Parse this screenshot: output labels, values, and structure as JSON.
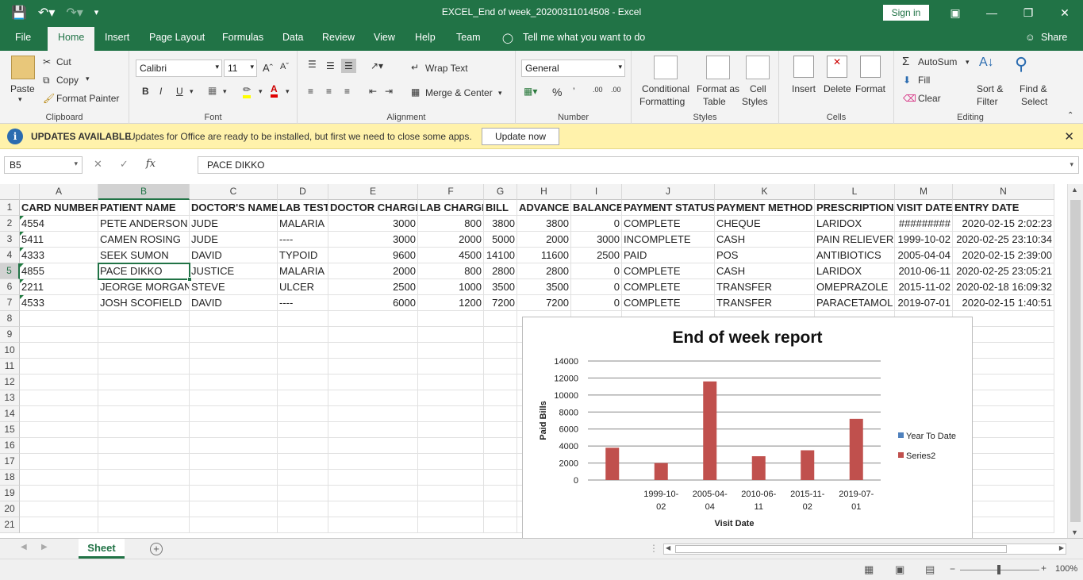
{
  "window": {
    "title": "EXCEL_End of week_20200311014508  -  Excel",
    "sign_in": "Sign in"
  },
  "tabs": [
    "File",
    "Home",
    "Insert",
    "Page Layout",
    "Formulas",
    "Data",
    "Review",
    "View",
    "Help",
    "Team"
  ],
  "tell_me": "Tell me what you want to do",
  "share": "Share",
  "ribbon": {
    "clipboard": {
      "paste": "Paste",
      "cut": "Cut",
      "copy": "Copy",
      "format_painter": "Format Painter",
      "label": "Clipboard"
    },
    "font": {
      "name": "Calibri",
      "size": "11",
      "label": "Font"
    },
    "alignment": {
      "wrap": "Wrap Text",
      "merge": "Merge & Center",
      "label": "Alignment"
    },
    "number": {
      "format": "General",
      "label": "Number"
    },
    "styles": {
      "conditional": "Conditional",
      "formatting": "Formatting",
      "format_as": "Format as",
      "table": "Table",
      "cell": "Cell",
      "cell_styles": "Styles",
      "label": "Styles"
    },
    "cells": {
      "insert": "Insert",
      "delete": "Delete",
      "format": "Format",
      "label": "Cells"
    },
    "editing": {
      "autosum": "AutoSum",
      "fill": "Fill",
      "clear": "Clear",
      "sort": "Sort &",
      "filter": "Filter",
      "find": "Find &",
      "select": "Select",
      "label": "Editing"
    }
  },
  "message_bar": {
    "title": "UPDATES AVAILABLE",
    "text": "Updates for Office are ready to be installed, but first we need to close some apps.",
    "button": "Update now"
  },
  "formula_bar": {
    "name_box": "B5",
    "formula": "PACE DIKKO"
  },
  "columns": [
    "A",
    "B",
    "C",
    "D",
    "E",
    "F",
    "G",
    "H",
    "I",
    "J",
    "K",
    "L",
    "M",
    "N"
  ],
  "rows": [
    "1",
    "2",
    "3",
    "4",
    "5",
    "6",
    "7",
    "8",
    "9",
    "10",
    "11",
    "12",
    "13",
    "14",
    "15",
    "16",
    "17",
    "18",
    "19",
    "20",
    "21"
  ],
  "sheet": [
    [
      "CARD NUMBER",
      "PATIENT NAME",
      "DOCTOR'S NAME",
      "LAB TEST",
      "DOCTOR CHARGE",
      "LAB CHARGE",
      "BILL",
      "ADVANCE",
      "BALANCE",
      "PAYMENT STATUS",
      "PAYMENT METHOD",
      "PRESCRIPTION",
      "VISIT DATE",
      "ENTRY DATE"
    ],
    [
      "4554",
      "PETE ANDERSON",
      "JUDE",
      "MALARIA",
      "3000",
      "800",
      "3800",
      "3800",
      "0",
      "COMPLETE",
      "CHEQUE",
      "LARIDOX",
      "#########",
      "2020-02-15 2:02:23"
    ],
    [
      "5411",
      "CAMEN ROSING",
      "JUDE",
      "----",
      "3000",
      "2000",
      "5000",
      "2000",
      "3000",
      "INCOMPLETE",
      "CASH",
      "PAIN RELIEVER",
      "1999-10-02",
      "2020-02-25 23:10:34"
    ],
    [
      "4333",
      "SEEK SUMON",
      "DAVID",
      "TYPOID",
      "9600",
      "4500",
      "14100",
      "11600",
      "2500",
      "PAID",
      "POS",
      "ANTIBIOTICS",
      "2005-04-04",
      "2020-02-15 2:39:00"
    ],
    [
      "4855",
      "PACE DIKKO",
      "JUSTICE",
      "MALARIA",
      "2000",
      "800",
      "2800",
      "2800",
      "0",
      "COMPLETE",
      "CASH",
      "LARIDOX",
      "2010-06-11",
      "2020-02-25 23:05:21"
    ],
    [
      "2211",
      "JEORGE MORGAN",
      "STEVE",
      "ULCER",
      "2500",
      "1000",
      "3500",
      "3500",
      "0",
      "COMPLETE",
      "TRANSFER",
      "OMEPRAZOLE",
      "2015-11-02",
      "2020-02-18 16:09:32"
    ],
    [
      "4533",
      "JOSH SCOFIELD",
      "DAVID",
      "----",
      "6000",
      "1200",
      "7200",
      "7200",
      "0",
      "COMPLETE",
      "TRANSFER",
      "PARACETAMOL",
      "2019-07-01",
      "2020-02-15 1:40:51"
    ]
  ],
  "chart_data": {
    "type": "bar",
    "title": "End of week report",
    "xlabel": "Visit Date",
    "ylabel": "Paid Bills",
    "categories": [
      "",
      "1999-10-02",
      "2005-04-04",
      "2010-06-11",
      "2015-11-02",
      "2019-07-01"
    ],
    "category_lines": [
      [
        "",
        ""
      ],
      [
        "1999-10-",
        "02"
      ],
      [
        "2005-04-",
        "04"
      ],
      [
        "2010-06-",
        "11"
      ],
      [
        "2015-11-",
        "02"
      ],
      [
        "2019-07-",
        "01"
      ]
    ],
    "series": [
      {
        "name": "Year To Date",
        "values": [
          0,
          0,
          0,
          0,
          0,
          0
        ],
        "color": "#4f81bd"
      },
      {
        "name": "Series2",
        "values": [
          3800,
          2000,
          11600,
          2800,
          3500,
          7200
        ],
        "color": "#c0504d"
      }
    ],
    "ylim": [
      0,
      14000
    ],
    "yticks": [
      "14000",
      "12000",
      "10000",
      "8000",
      "6000",
      "4000",
      "2000",
      "0"
    ],
    "legend": "right",
    "grid": true
  },
  "sheet_tab": "Sheet",
  "status": {
    "zoom": "100%"
  },
  "colors": {
    "excel_green": "#217346",
    "bar": "#c0504d"
  }
}
